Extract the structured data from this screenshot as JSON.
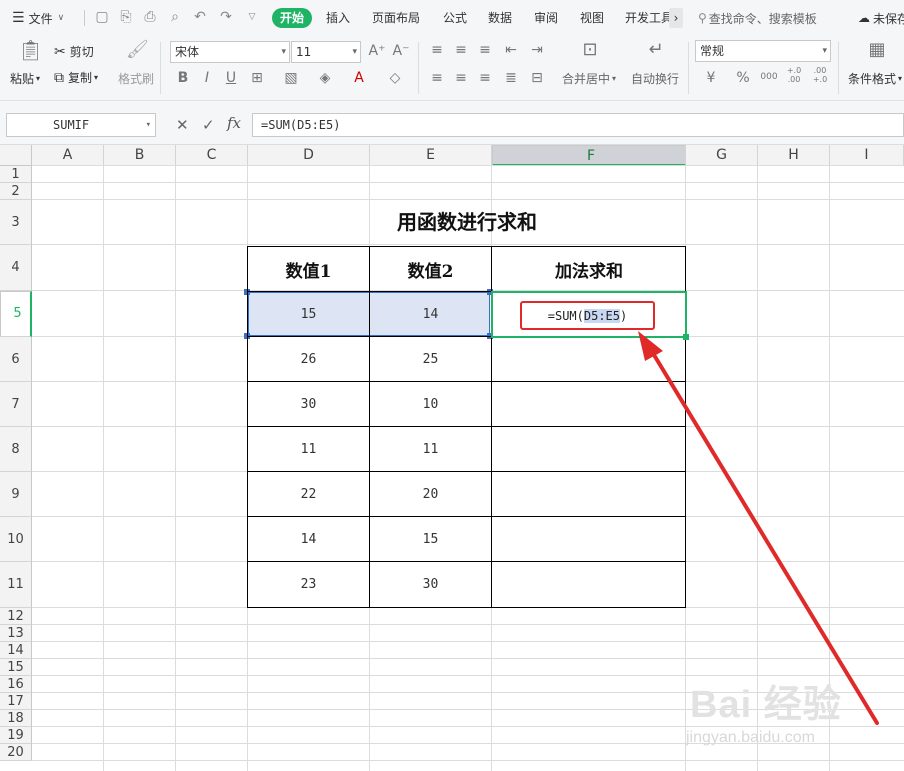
{
  "menubar": {
    "file_label": "文件",
    "tabs": [
      "开始",
      "插入",
      "页面布局",
      "公式",
      "数据",
      "审阅",
      "视图",
      "开发工具"
    ],
    "search_placeholder": "查找命令、搜索模板",
    "unsaved_label": "未保存"
  },
  "ribbon": {
    "paste": "粘贴",
    "cut": "剪切",
    "copy": "复制",
    "format_painter": "格式刷",
    "font_name": "宋体",
    "font_size": "11",
    "merge_center": "合并居中",
    "wrap_text": "自动换行",
    "number_format": "常规",
    "conditional_format": "条件格式",
    "percent": "%",
    "thousands": "000",
    "currency": "¥",
    "inc_decimal": "+.0 .00",
    "dec_decimal": ".00 +.0"
  },
  "formula_bar": {
    "name_box": "SUMIF",
    "fx": "fx",
    "formula": "=SUM(D5:E5)"
  },
  "columns": [
    "A",
    "B",
    "C",
    "D",
    "E",
    "F",
    "G",
    "H",
    "I"
  ],
  "rows": [
    "1",
    "2",
    "3",
    "4",
    "5",
    "6",
    "7",
    "8",
    "9",
    "10",
    "11",
    "12",
    "13",
    "14",
    "15",
    "16",
    "17",
    "18",
    "19",
    "20"
  ],
  "sheet": {
    "title": "用函数进行求和",
    "headers": [
      "数值1",
      "数值2",
      "加法求和"
    ],
    "data": [
      [
        "15",
        "14"
      ],
      [
        "26",
        "25"
      ],
      [
        "30",
        "10"
      ],
      [
        "11",
        "11"
      ],
      [
        "22",
        "20"
      ],
      [
        "14",
        "15"
      ],
      [
        "23",
        "30"
      ]
    ],
    "formula_cell": {
      "prefix": "=SUM(",
      "ref": "D5:E5",
      "suffix": ")"
    }
  },
  "watermark": {
    "logo": "Bai 经验",
    "url": "jingyan.baidu.com"
  },
  "colors": {
    "accent": "#1fb465",
    "annotation": "#e02a2a",
    "selection": "#dde4f3"
  }
}
